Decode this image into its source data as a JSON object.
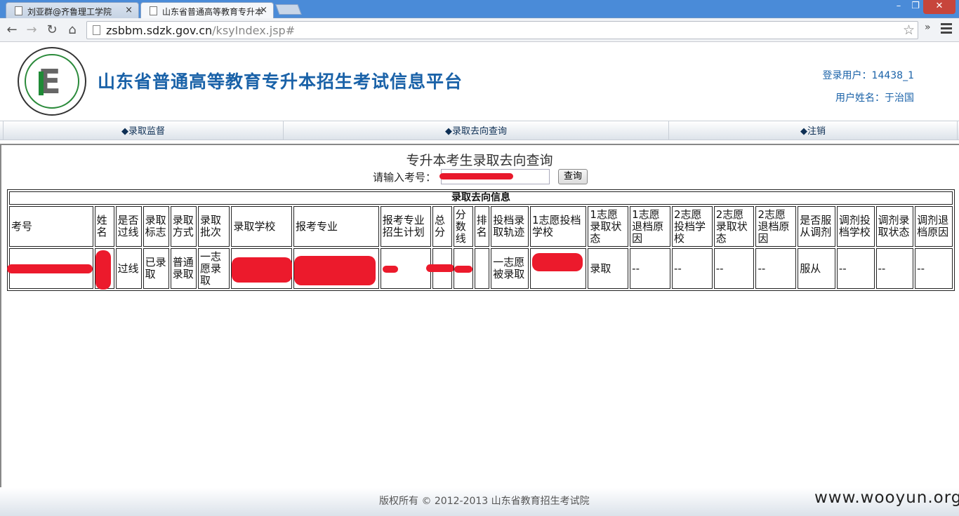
{
  "browser": {
    "tabs": [
      {
        "label": "刘亚群@齐鲁理工学院",
        "active": false
      },
      {
        "label": "山东省普通高等教育专升本",
        "active": true
      }
    ],
    "url_host": "zsbbm.sdzk.gov.cn",
    "url_path": "/ksyIndex.jsp#"
  },
  "header": {
    "site_title": "山东省普通高等教育专升本招生考试信息平台",
    "login_user": "登录用户：14438_1",
    "user_name": "用户姓名：于治国"
  },
  "menu": {
    "items": [
      "◆录取监督",
      "◆录取去向查询",
      "◆注销"
    ]
  },
  "query": {
    "heading": "专升本考生录取去向查询",
    "label": "请输入考号：",
    "button": "查询"
  },
  "result": {
    "caption": "录取去向信息",
    "columns": [
      "考号",
      "姓名",
      "是否过线",
      "录取标志",
      "录取方式",
      "录取批次",
      "录取学校",
      "报考专业",
      "报考专业招生计划",
      "总分",
      "分数线",
      "排名",
      "投档录取轨迹",
      "1志愿投档学校",
      "1志愿录取状态",
      "1志愿退档原因",
      "2志愿投档学校",
      "2志愿录取状态",
      "2志愿退档原因",
      "是否服从调剂",
      "调剂投档学校",
      "调剂录取状态",
      "调剂退档原因"
    ],
    "row": [
      "",
      "",
      "过线",
      "已录取",
      "普通录取",
      "一志愿录取",
      "",
      "",
      "",
      "",
      "",
      "",
      "一志愿被录取",
      "",
      "录取",
      "--",
      "--",
      "--",
      "--",
      "服从",
      "--",
      "--",
      "--"
    ]
  },
  "footer": {
    "copyright": "版权所有 © 2012-2013 山东省教育招生考试院",
    "watermark": "www.wooyun.org"
  }
}
